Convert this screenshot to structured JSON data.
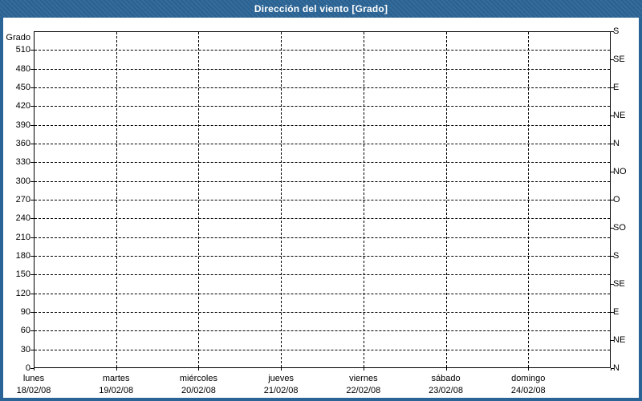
{
  "window": {
    "title": "Dirección del viento [Grado]"
  },
  "colors": {
    "frame": "#2a6496",
    "title_bar": "#2a6496",
    "title_text": "#ffffff",
    "plot_background": "#ffffff",
    "axis": "#000000",
    "text": "#000000"
  },
  "chart_data": {
    "type": "line",
    "title": "Dirección del viento [Grado]",
    "ylabel_left": "Grado",
    "ylim": [
      0,
      540
    ],
    "y_left_ticks": [
      0,
      30,
      60,
      90,
      120,
      150,
      180,
      210,
      240,
      270,
      300,
      330,
      360,
      390,
      420,
      450,
      480,
      510
    ],
    "y_right_ticks": [
      {
        "value": 0,
        "label": "N"
      },
      {
        "value": 45,
        "label": "NE"
      },
      {
        "value": 90,
        "label": "E"
      },
      {
        "value": 135,
        "label": "SE"
      },
      {
        "value": 180,
        "label": "S"
      },
      {
        "value": 225,
        "label": "SO"
      },
      {
        "value": 270,
        "label": "O"
      },
      {
        "value": 315,
        "label": "NO"
      },
      {
        "value": 360,
        "label": "N"
      },
      {
        "value": 405,
        "label": "NE"
      },
      {
        "value": 450,
        "label": "E"
      },
      {
        "value": 495,
        "label": "SE"
      },
      {
        "value": 540,
        "label": "S"
      }
    ],
    "x_categories": [
      {
        "day": "lunes",
        "date": "18/02/08"
      },
      {
        "day": "martes",
        "date": "19/02/08"
      },
      {
        "day": "miércoles",
        "date": "20/02/08"
      },
      {
        "day": "jueves",
        "date": "21/02/08"
      },
      {
        "day": "viernes",
        "date": "22/02/08"
      },
      {
        "day": "sábado",
        "date": "23/02/08"
      },
      {
        "day": "domingo",
        "date": "24/02/08"
      }
    ],
    "grid": "dashed",
    "legend": null,
    "series": []
  }
}
